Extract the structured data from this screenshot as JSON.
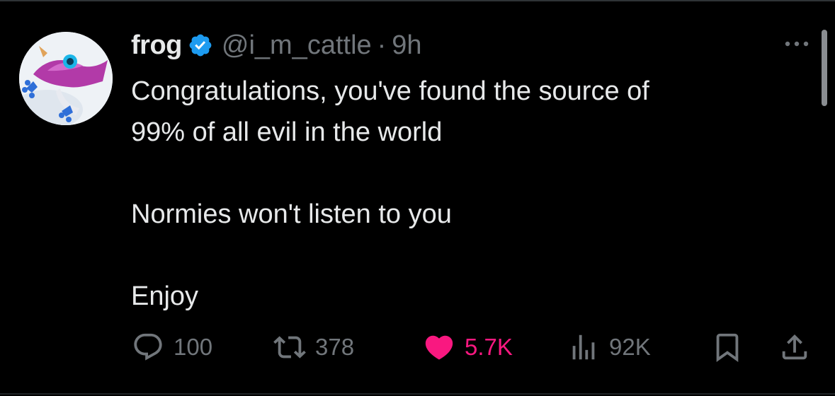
{
  "post": {
    "author": {
      "display_name": "frog",
      "handle": "@i_m_cattle",
      "verified": true
    },
    "separator": "·",
    "timestamp": "9h",
    "text_lines": [
      "Congratulations, you've found the source of",
      "99% of all evil in the world",
      "",
      "Normies won't listen to you",
      "",
      "Enjoy"
    ],
    "metrics": {
      "replies": "100",
      "reposts": "378",
      "likes": "5.7K",
      "views": "92K"
    },
    "liked": true
  },
  "icons": {
    "more": "more-horizontal-icon",
    "verified": "verified-badge-icon",
    "reply": "reply-icon",
    "repost": "repost-icon",
    "like": "heart-icon",
    "views": "views-icon",
    "bookmark": "bookmark-icon",
    "share": "share-icon"
  },
  "colors": {
    "background": "#000000",
    "text_primary": "#e7e9ea",
    "text_secondary": "#71767b",
    "verified": "#1d9bf0",
    "like_active": "#f91880"
  }
}
